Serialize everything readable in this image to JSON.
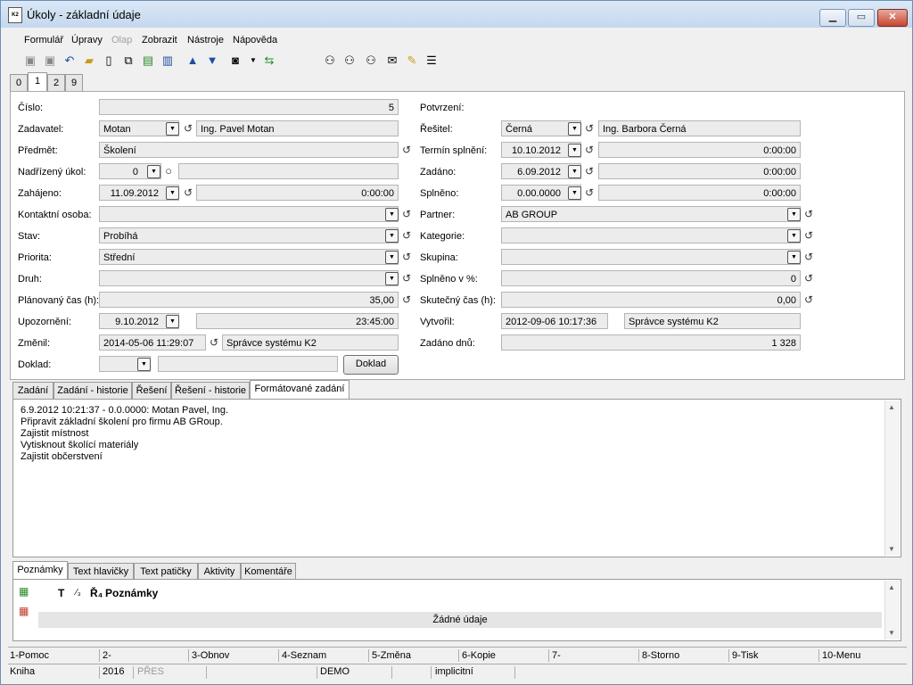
{
  "window": {
    "title": "Úkoly - základní údaje",
    "icon_text": "K2"
  },
  "menu": [
    "Formulář",
    "Úpravy",
    "Olap",
    "Zobrazit",
    "Nástroje",
    "Nápověda"
  ],
  "tabs_top": [
    "0",
    "1",
    "2",
    "9"
  ],
  "form": {
    "cislo": {
      "label": "Číslo:",
      "value": "5"
    },
    "zadavatel": {
      "label": "Zadavatel:",
      "value": "Motan",
      "name": "Ing. Pavel Motan"
    },
    "predmet": {
      "label": "Předmět:",
      "value": "Školení"
    },
    "nadrizeny": {
      "label": "Nadřízený úkol:",
      "value": "0",
      "extra": ""
    },
    "zahajeno": {
      "label": "Zahájeno:",
      "date": "11.09.2012",
      "time": "0:00:00"
    },
    "kontakt": {
      "label": "Kontaktní osoba:",
      "value": ""
    },
    "stav": {
      "label": "Stav:",
      "value": "Probíhá"
    },
    "priorita": {
      "label": "Priorita:",
      "value": "Střední"
    },
    "druh": {
      "label": "Druh:",
      "value": ""
    },
    "planovany": {
      "label": "Plánovaný čas (h):",
      "value": "35,00"
    },
    "upozorneni": {
      "label": "Upozornění:",
      "date": "9.10.2012",
      "time": "23:45:00"
    },
    "zmenil": {
      "label": "Změnil:",
      "datetime": "2014-05-06 11:29:07",
      "user": "Správce systému K2"
    },
    "doklad": {
      "label": "Doklad:",
      "value": "",
      "extra": "",
      "button": "Doklad"
    },
    "potvrzeni": {
      "label": "Potvrzení:"
    },
    "resitel": {
      "label": "Řešitel:",
      "value": "Černá",
      "name": "Ing. Barbora Černá"
    },
    "termin": {
      "label": "Termín splnění:",
      "date": "10.10.2012",
      "time": "0:00:00"
    },
    "zadano": {
      "label": "Zadáno:",
      "date": "6.09.2012",
      "time": "0:00:00"
    },
    "splneno": {
      "label": "Splněno:",
      "date": "0.00.0000",
      "time": "0:00:00"
    },
    "partner": {
      "label": "Partner:",
      "value": "AB GROUP"
    },
    "kategorie": {
      "label": "Kategorie:",
      "value": ""
    },
    "skupina": {
      "label": "Skupina:",
      "value": ""
    },
    "splneno_pct": {
      "label": "Splněno v %:",
      "value": "0"
    },
    "skutecny": {
      "label": "Skutečný čas (h):",
      "value": "0,00"
    },
    "vytvoril": {
      "label": "Vytvořil:",
      "datetime": "2012-09-06 10:17:36",
      "user": "Správce systému K2"
    },
    "zadano_dnu": {
      "label": "Zadáno dnů:",
      "value": "1 328"
    }
  },
  "tabs_mid": [
    "Zadání",
    "Zadání - historie",
    "Řešení",
    "Řešení - historie",
    "Formátované zadání"
  ],
  "memo_lines": [
    "6.9.2012 10:21:37 - 0.0.0000: Motan Pavel, Ing.",
    "Připravit základní školení pro firmu AB GRoup.",
    "Zajistit místnost",
    "Vytisknout školící materiály",
    "Zajistit občerstvení"
  ],
  "tabs_bot": [
    "Poznámky",
    "Text hlavičky",
    "Text patičky",
    "Aktivity",
    "Komentáře"
  ],
  "notes": {
    "col_t": "T",
    "col_num": "⁄₃",
    "col_r": "Ř₄",
    "col_title": "Poznámky",
    "empty": "Žádné údaje"
  },
  "fkeys": [
    "1-Pomoc",
    "2-",
    "3-Obnov",
    "4-Seznam",
    "5-Změna",
    "6-Kopie",
    "7-",
    "8-Storno",
    "9-Tisk",
    "10-Menu"
  ],
  "status": {
    "kniha": "Kniha",
    "year": "2016",
    "mode": "PŘES",
    "db": "DEMO",
    "layout": "implicitní"
  }
}
